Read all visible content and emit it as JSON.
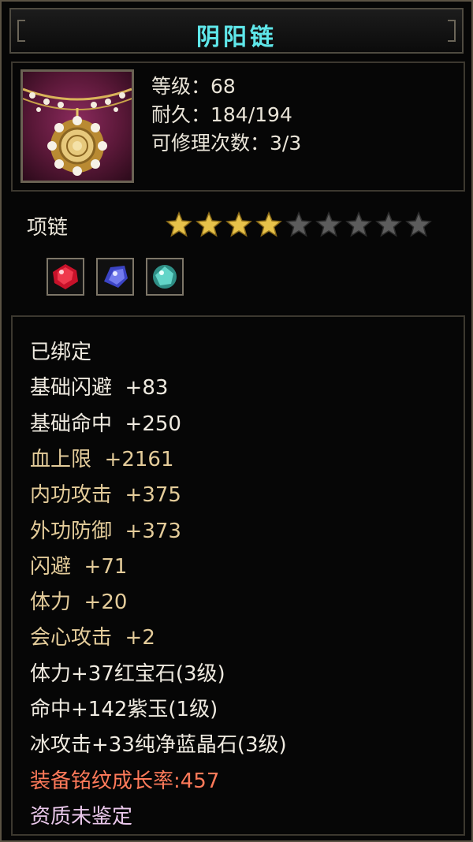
{
  "window": {
    "title": "阴阳链"
  },
  "item": {
    "icon": "necklace-icon",
    "level": "等级：68",
    "durability": "耐久：184/194",
    "repairs": "可修理次数：3/3",
    "type": "项链",
    "stars_filled": 4,
    "stars_total": 9
  },
  "gems": [
    {
      "icon": "ruby-gem-icon",
      "color": "#c8122a"
    },
    {
      "icon": "amethyst-gem-icon",
      "color": "#4a55d8"
    },
    {
      "icon": "blue-crystal-gem-icon",
      "color": "#47d1c8"
    }
  ],
  "attributes": [
    {
      "text": "已绑定",
      "color": "white"
    },
    {
      "text": "基础闪避  +83",
      "color": "white"
    },
    {
      "text": "基础命中  +250",
      "color": "white"
    },
    {
      "text": "血上限  +2161",
      "color": "tan"
    },
    {
      "text": "内功攻击  +375",
      "color": "tan"
    },
    {
      "text": "外功防御  +373",
      "color": "tan"
    },
    {
      "text": "闪避  +71",
      "color": "tan"
    },
    {
      "text": "体力  +20",
      "color": "tan"
    },
    {
      "text": "会心攻击  +2",
      "color": "tan"
    },
    {
      "text": "体力+37红宝石(3级)",
      "color": "white"
    },
    {
      "text": "命中+142紫玉(1级)",
      "color": "white"
    },
    {
      "text": "冰攻击+33纯净蓝晶石(3级)",
      "color": "white"
    },
    {
      "text": "装备铭纹成长率:457",
      "color": "red"
    },
    {
      "text": "资质未鉴定",
      "color": "pink"
    }
  ],
  "colors": {
    "title": "#5fe7ea",
    "star_filled": "#e7c24a",
    "star_empty": "#5c5c5c"
  }
}
